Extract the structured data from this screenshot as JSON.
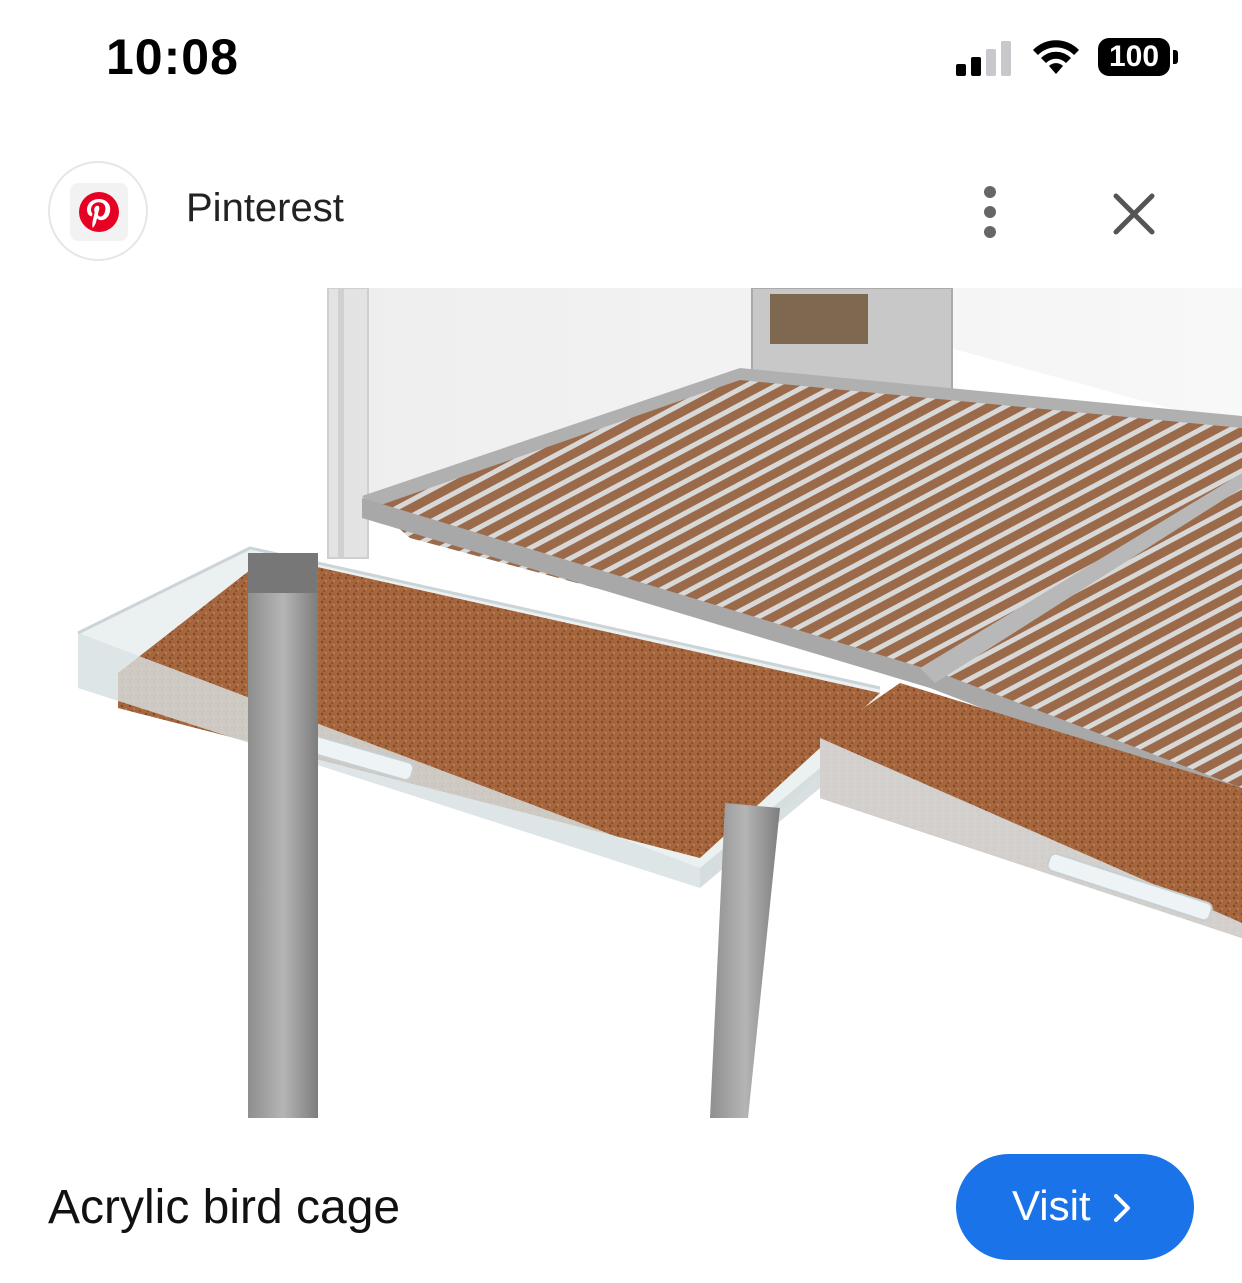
{
  "status_bar": {
    "time": "10:08",
    "battery_level": "100",
    "signal_icon": "cellular-signal-icon",
    "wifi_icon": "wifi-icon"
  },
  "header": {
    "app_name": "Pinterest",
    "logo_icon": "pinterest-logo-icon",
    "more_icon": "more-vertical-icon",
    "close_icon": "close-icon"
  },
  "pin": {
    "image_subject": "acrylic-bird-cage-photo",
    "title": "Acrylic bird cage"
  },
  "actions": {
    "visit_label": "Visit",
    "visit_icon": "chevron-right-icon"
  },
  "colors": {
    "pinterest_red": "#e60023",
    "visit_blue": "#1a73e8"
  }
}
